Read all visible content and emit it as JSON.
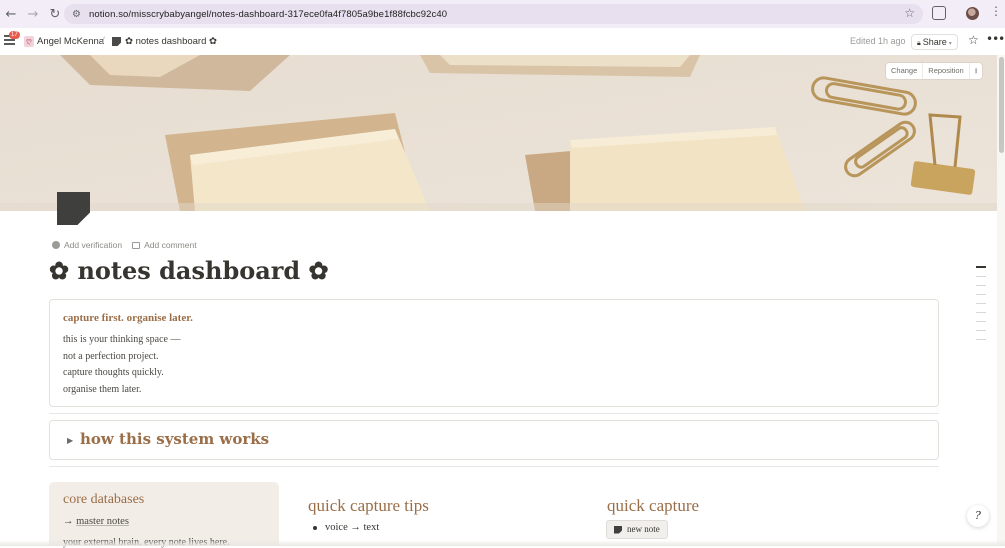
{
  "browser": {
    "url": "notion.so/misscrybabyangel/notes-dashboard-317ece0fa4f7805a9be1f88fcbc92c40",
    "back_icon": "arrow-left-icon",
    "forward_icon": "arrow-right-icon",
    "reload_icon": "reload-icon"
  },
  "topbar": {
    "notification_count": "17",
    "workspace": "Angel McKenna",
    "breadcrumb_sep": "/",
    "page": "✿ notes dashboard ✿",
    "edited": "Edited 1h ago",
    "share_label": "Share"
  },
  "cover": {
    "change_label": "Change",
    "reposition_label": "Reposition"
  },
  "meta": {
    "verification": "Add verification",
    "comment": "Add comment"
  },
  "page": {
    "title": "✿ notes dashboard ✿"
  },
  "callout": {
    "heading": "capture first. organise later.",
    "lines": [
      "this is your thinking space —",
      "not a perfection project.",
      "capture thoughts quickly.",
      "organise them later."
    ]
  },
  "toggle": {
    "title": "how this system works"
  },
  "core": {
    "title": "core databases",
    "arrow": "→",
    "link": "master notes",
    "desc": "your external brain. every note lives here."
  },
  "tips": {
    "title": "quick capture tips",
    "item": "voice → text"
  },
  "quick_capture": {
    "title": "quick capture",
    "button": "new note"
  },
  "colors": {
    "accent": "#9a6e47",
    "chrome_bg": "#f3edf7",
    "core_bg": "#f3ede8"
  }
}
